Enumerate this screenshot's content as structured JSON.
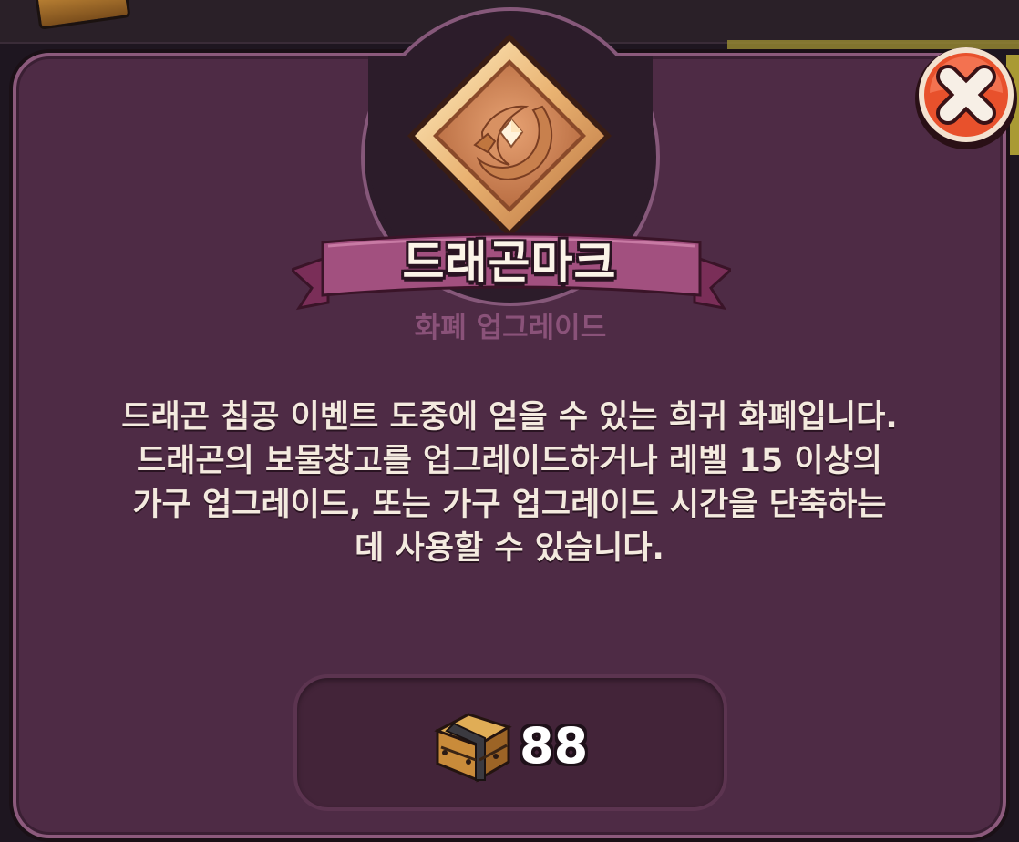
{
  "popup": {
    "title": "드래곤마크",
    "subtitle": "화폐 업그레이드",
    "description": "드래곤 침공 이벤트 도중에 얻을 수 있는 희귀 화폐입니다. 드래곤의 보물창고를 업그레이드하거나 레벨 15 이상의 가구 업그레이드, 또는 가구 업그레이드 시간을 단축하는 데 사용할 수 있습니다.",
    "item_icon": "dragon-mark-icon",
    "owned": {
      "icon": "treasure-crate-icon",
      "count": "88"
    },
    "close_icon": "close-x-icon"
  },
  "colors": {
    "panel": "#4e2b45",
    "panel_border": "#8c5a7c",
    "ribbon": "#a2507f",
    "close_button": "#e8512c",
    "medal_gold": "#e3a36a"
  }
}
